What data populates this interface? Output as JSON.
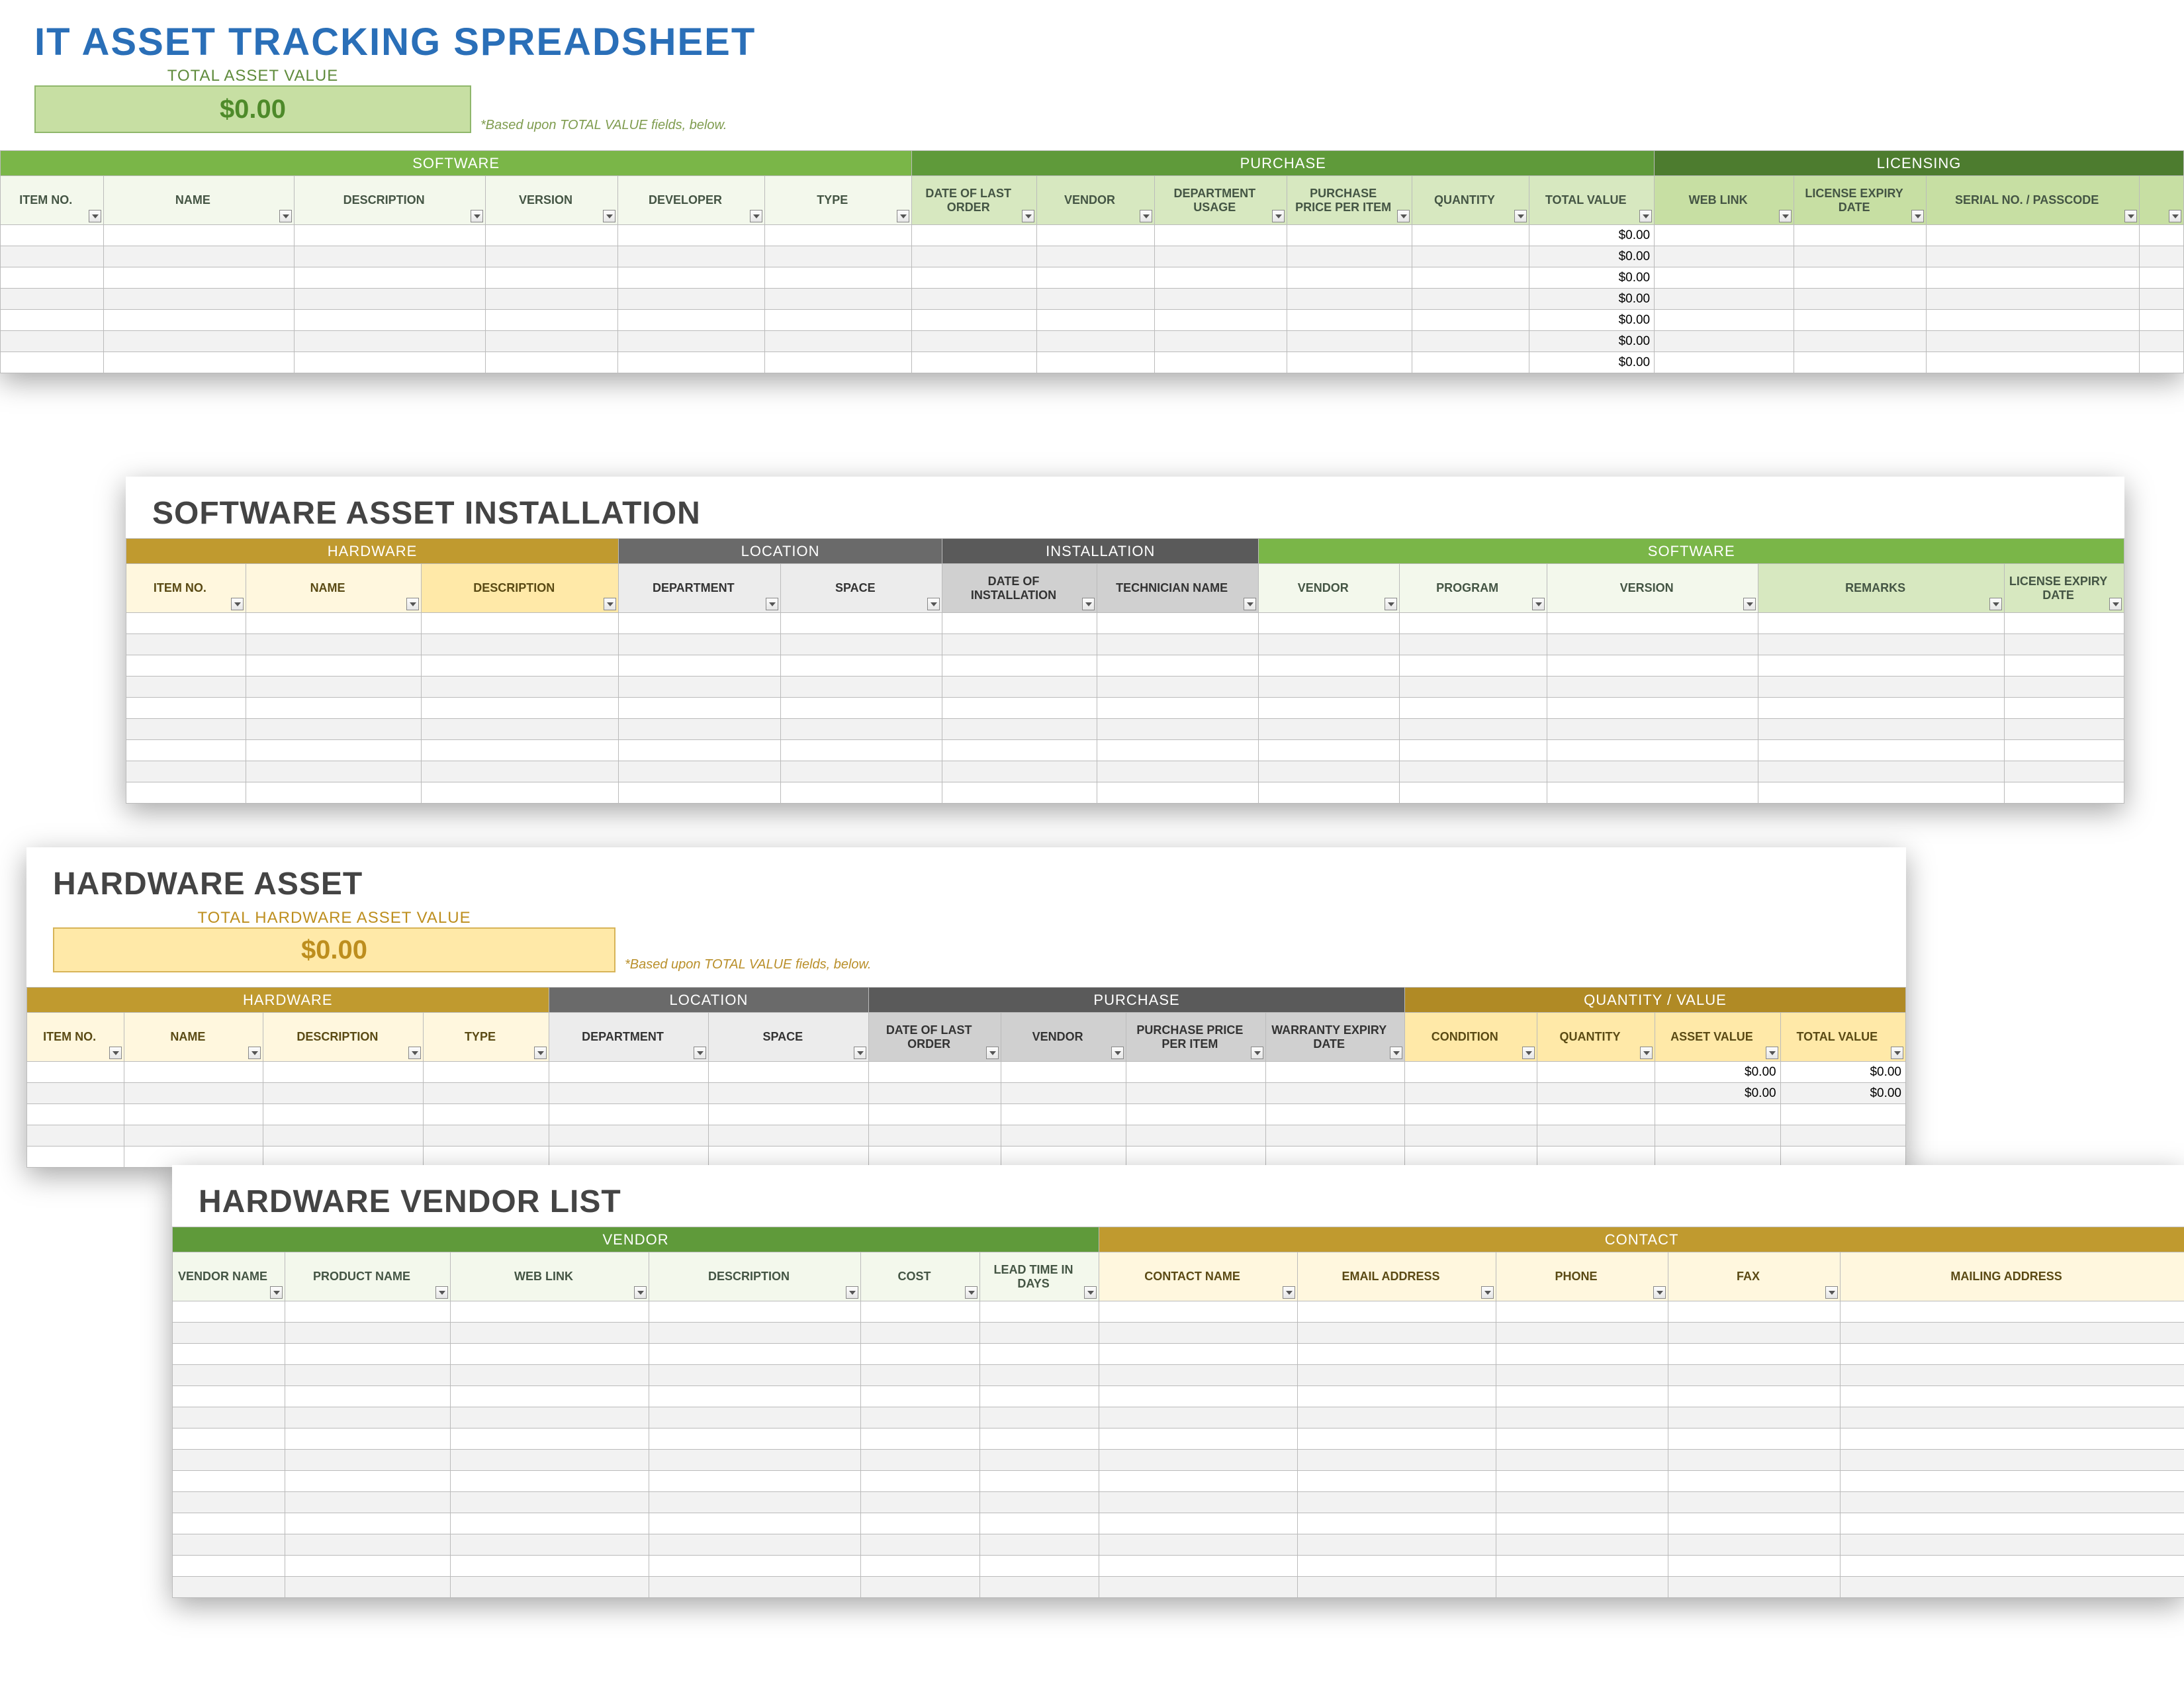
{
  "sheet1": {
    "title": "IT ASSET TRACKING SPREADSHEET",
    "tav_label": "TOTAL ASSET VALUE",
    "tav_value": "$0.00",
    "tav_note": "*Based upon TOTAL VALUE fields, below.",
    "groups": {
      "software": "SOFTWARE",
      "purchase": "PURCHASE",
      "licensing": "LICENSING"
    },
    "cols": {
      "item_no": "ITEM NO.",
      "name": "NAME",
      "description": "DESCRIPTION",
      "version": "VERSION",
      "developer": "DEVELOPER",
      "type": "TYPE",
      "date_last_order": "DATE OF LAST ORDER",
      "vendor": "VENDOR",
      "dept_usage": "DEPARTMENT USAGE",
      "price_per_item": "PURCHASE PRICE PER ITEM",
      "quantity": "QUANTITY",
      "total_value": "TOTAL VALUE",
      "web_link": "WEB LINK",
      "license_expiry": "LICENSE EXPIRY DATE",
      "serial_passcode": "SERIAL NO. / PASSCODE"
    },
    "row_total": "$0.00"
  },
  "sheet2": {
    "title": "SOFTWARE ASSET INSTALLATION",
    "groups": {
      "hardware": "HARDWARE",
      "location": "LOCATION",
      "installation": "INSTALLATION",
      "software": "SOFTWARE"
    },
    "cols": {
      "item_no": "ITEM NO.",
      "name": "NAME",
      "description": "DESCRIPTION",
      "department": "DEPARTMENT",
      "space": "SPACE",
      "date_install": "DATE OF INSTALLATION",
      "tech_name": "TECHNICIAN NAME",
      "vendor": "VENDOR",
      "program": "PROGRAM",
      "version": "VERSION",
      "remarks": "REMARKS",
      "license_expiry": "LICENSE EXPIRY DATE"
    }
  },
  "sheet3": {
    "title": "HARDWARE ASSET",
    "tav_label": "TOTAL HARDWARE ASSET VALUE",
    "tav_value": "$0.00",
    "tav_note": "*Based upon TOTAL VALUE fields, below.",
    "groups": {
      "hardware": "HARDWARE",
      "location": "LOCATION",
      "purchase": "PURCHASE",
      "qtyval": "QUANTITY / VALUE"
    },
    "cols": {
      "item_no": "ITEM NO.",
      "name": "NAME",
      "description": "DESCRIPTION",
      "type": "TYPE",
      "department": "DEPARTMENT",
      "space": "SPACE",
      "date_last_order": "DATE OF LAST ORDER",
      "vendor": "VENDOR",
      "price_per_item": "PURCHASE PRICE PER ITEM",
      "warranty_expiry": "WARRANTY EXPIRY DATE",
      "condition": "CONDITION",
      "quantity": "QUANTITY",
      "asset_value": "ASSET VALUE",
      "total_value": "TOTAL VALUE"
    },
    "row_total": "$0.00"
  },
  "sheet4": {
    "title": "HARDWARE VENDOR LIST",
    "groups": {
      "vendor": "VENDOR",
      "contact": "CONTACT"
    },
    "cols": {
      "vendor_name": "VENDOR NAME",
      "product_name": "PRODUCT NAME",
      "web_link": "WEB LINK",
      "description": "DESCRIPTION",
      "cost": "COST",
      "lead_time": "LEAD TIME IN DAYS",
      "contact_name": "CONTACT NAME",
      "email": "EMAIL ADDRESS",
      "phone": "PHONE",
      "fax": "FAX",
      "mailing": "MAILING ADDRESS"
    }
  }
}
